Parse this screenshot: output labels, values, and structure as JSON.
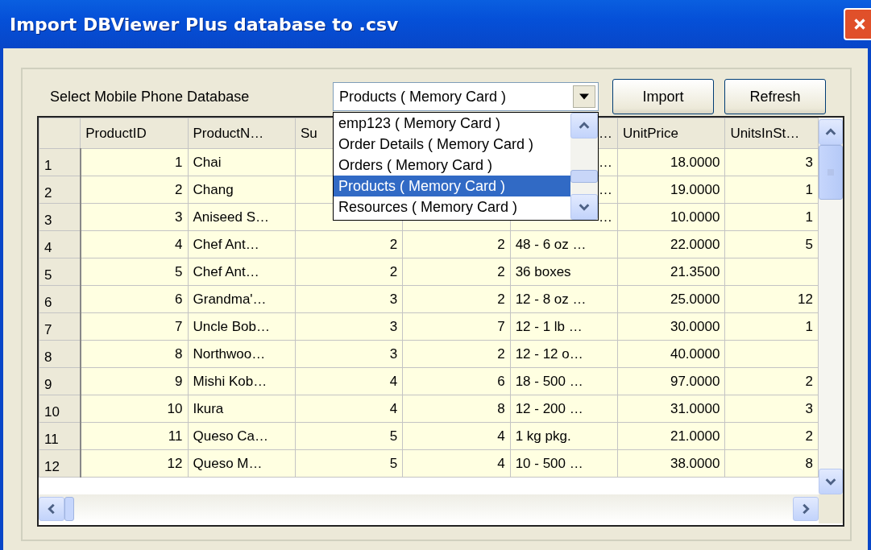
{
  "window": {
    "title": "Import DBViewer Plus database to .csv"
  },
  "database_picker": {
    "label": "Select Mobile Phone Database",
    "value": "Products ( Memory Card )",
    "expanded": true,
    "options": [
      {
        "label": "emp123 ( Memory Card )",
        "selected": false
      },
      {
        "label": "Order Details ( Memory Card )",
        "selected": false
      },
      {
        "label": "Orders ( Memory Card )",
        "selected": false
      },
      {
        "label": "Products ( Memory Card )",
        "selected": true
      },
      {
        "label": "Resources ( Memory Card )",
        "selected": false
      }
    ]
  },
  "buttons": [
    "Import",
    "Refresh"
  ],
  "table": {
    "columns": [
      {
        "header": "ProductID",
        "kind": "number"
      },
      {
        "header": "ProductN…",
        "kind": "text"
      },
      {
        "header": "Su",
        "kind": "number"
      },
      {
        "kind": "number"
      },
      {
        "header": "…",
        "kind": "text",
        "header_clipped": true
      },
      {
        "header": "UnitPrice",
        "kind": "number"
      },
      {
        "header": "UnitsInSt…",
        "kind": "number"
      }
    ],
    "rows": [
      {
        "number": "1",
        "cells": [
          "1",
          "Chai",
          null,
          null,
          {
            "text": "…",
            "clipped": true
          },
          "18.0000",
          "3"
        ]
      },
      {
        "number": "2",
        "cells": [
          "2",
          "Chang",
          null,
          null,
          {
            "text": "…",
            "clipped": true
          },
          "19.0000",
          "1"
        ]
      },
      {
        "number": "3",
        "cells": [
          "3",
          "Aniseed S…",
          null,
          null,
          {
            "text": "…",
            "clipped": true
          },
          "10.0000",
          "1"
        ]
      },
      {
        "number": "4",
        "cells": [
          "4",
          "Chef Ant…",
          "2",
          "2",
          "48 - 6 oz …",
          "22.0000",
          "5"
        ]
      },
      {
        "number": "5",
        "cells": [
          "5",
          "Chef Ant…",
          "2",
          "2",
          "36 boxes",
          "21.3500",
          null
        ]
      },
      {
        "number": "6",
        "cells": [
          "6",
          "Grandma'…",
          "3",
          "2",
          "12 - 8 oz …",
          "25.0000",
          "12"
        ]
      },
      {
        "number": "7",
        "cells": [
          "7",
          "Uncle Bob…",
          "3",
          "7",
          "12 - 1 lb …",
          "30.0000",
          "1"
        ]
      },
      {
        "number": "8",
        "cells": [
          "8",
          "Northwoo…",
          "3",
          "2",
          "12 - 12 o…",
          "40.0000",
          null
        ]
      },
      {
        "number": "9",
        "cells": [
          "9",
          "Mishi Kob…",
          "4",
          "6",
          "18 - 500 …",
          "97.0000",
          "2"
        ]
      },
      {
        "number": "10",
        "cells": [
          "10",
          "Ikura",
          "4",
          "8",
          "12 - 200 …",
          "31.0000",
          "3"
        ]
      },
      {
        "number": "11",
        "cells": [
          "11",
          "Queso Ca…",
          "5",
          "4",
          "1 kg pkg.",
          "21.0000",
          "2"
        ]
      },
      {
        "number": "12",
        "cells": [
          "12",
          "Queso M…",
          "5",
          "4",
          "10 - 500 …",
          "38.0000",
          "8"
        ]
      }
    ]
  }
}
